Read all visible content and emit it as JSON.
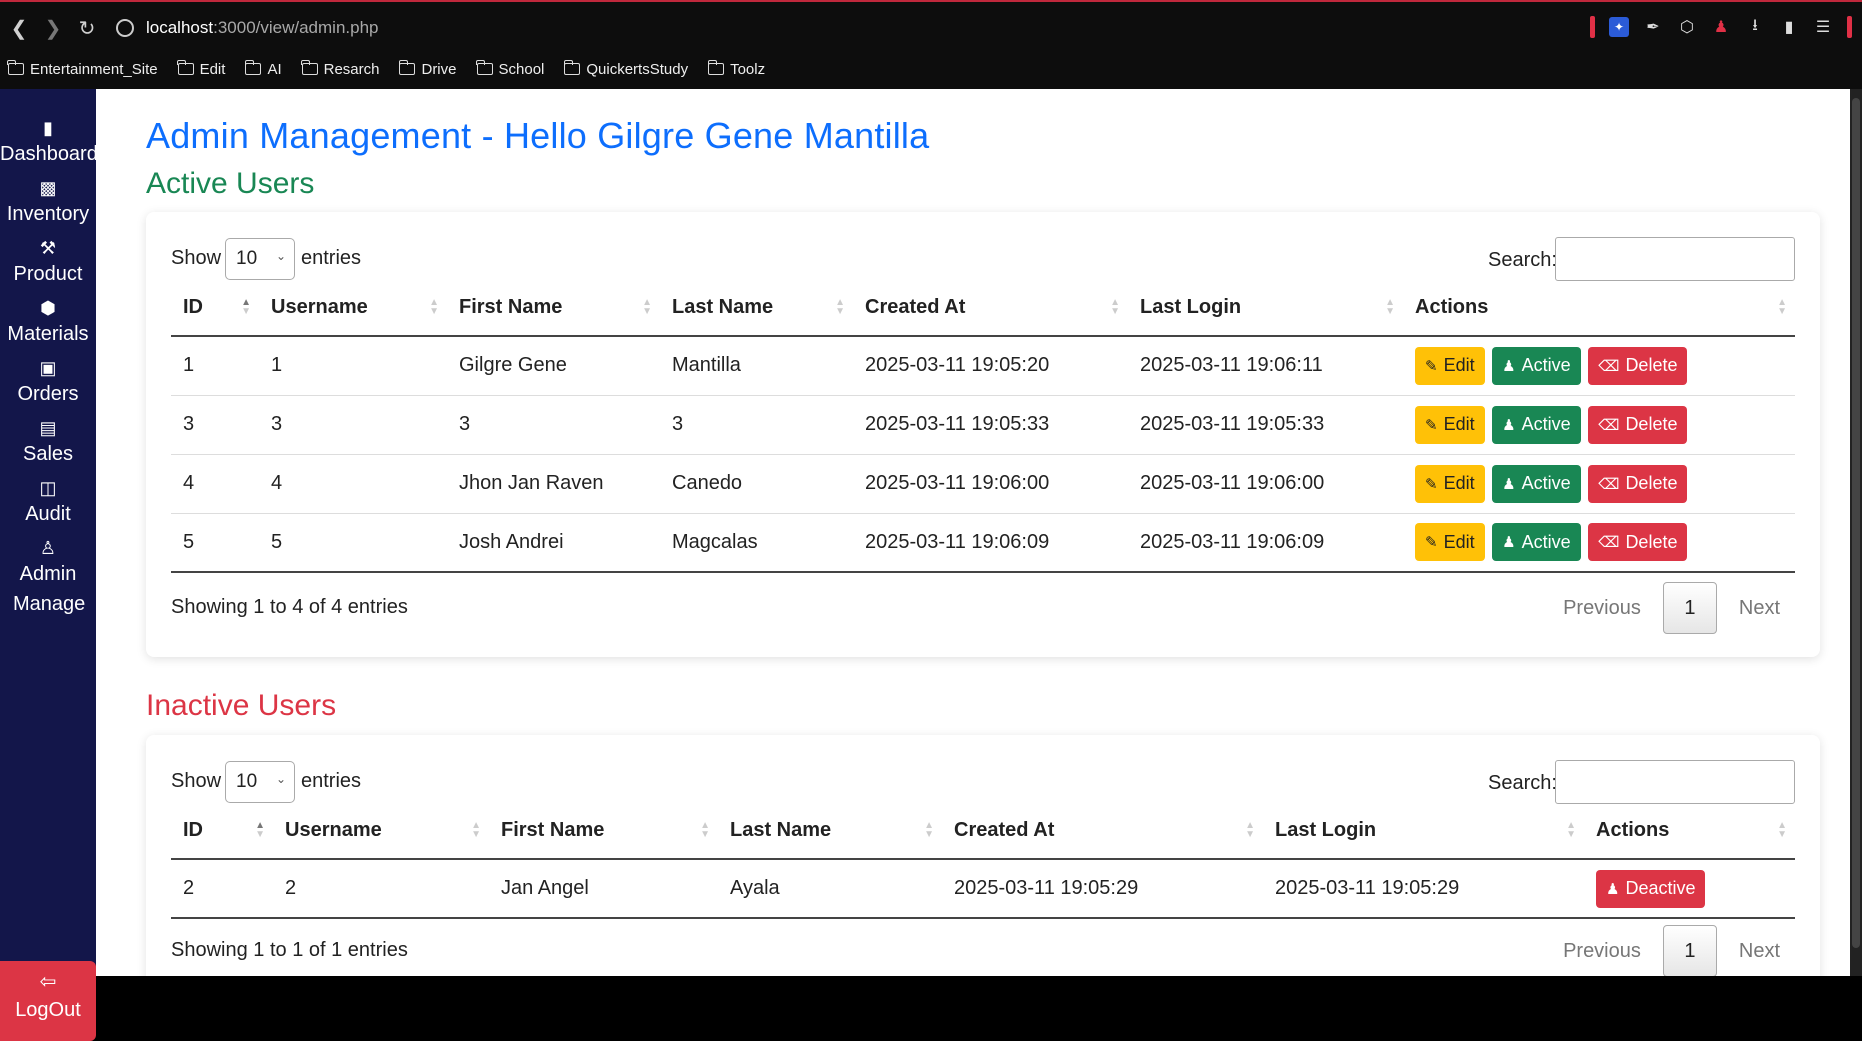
{
  "browser": {
    "url_host": "localhost",
    "url_rest": ":3000/view/admin.php",
    "bookmarks": [
      "Entertainment_Site",
      "Edit",
      "AI",
      "Resarch",
      "Drive",
      "School",
      "QuickertsStudy",
      "Toolz"
    ]
  },
  "sidebar": {
    "items": [
      {
        "label": "Dashboard",
        "icon": "bookmark-icon"
      },
      {
        "label": "Inventory",
        "icon": "bag-icon"
      },
      {
        "label": "Product",
        "icon": "hammer-icon"
      },
      {
        "label": "Materials",
        "icon": "hexagon-icon"
      },
      {
        "label": "Orders",
        "icon": "basket-icon"
      },
      {
        "label": "Sales",
        "icon": "receipt-icon"
      },
      {
        "label": "Audit",
        "icon": "journal-icon"
      },
      {
        "label": "Admin Manage",
        "icon": "person-gear-icon"
      }
    ],
    "logout": "LogOut"
  },
  "page": {
    "title": "Admin Management - Hello Gilgre Gene Mantilla",
    "active_heading": "Active Users",
    "inactive_heading": "Inactive Users"
  },
  "active_table": {
    "show_label": "Show",
    "entries_value": "10",
    "entries_label": "entries",
    "search_label": "Search:",
    "columns": [
      "ID",
      "Username",
      "First Name",
      "Last Name",
      "Created At",
      "Last Login",
      "Actions"
    ],
    "rows": [
      {
        "id": "1",
        "username": "1",
        "first": "Gilgre Gene",
        "last": "Mantilla",
        "created": "2025-03-11 19:05:20",
        "login": "2025-03-11 19:06:11"
      },
      {
        "id": "3",
        "username": "3",
        "first": "3",
        "last": "3",
        "created": "2025-03-11 19:05:33",
        "login": "2025-03-11 19:05:33"
      },
      {
        "id": "4",
        "username": "4",
        "first": "Jhon Jan Raven",
        "last": "Canedo",
        "created": "2025-03-11 19:06:00",
        "login": "2025-03-11 19:06:00"
      },
      {
        "id": "5",
        "username": "5",
        "first": "Josh Andrei",
        "last": "Magcalas",
        "created": "2025-03-11 19:06:09",
        "login": "2025-03-11 19:06:09"
      }
    ],
    "btn_edit": "Edit",
    "btn_active": "Active",
    "btn_delete": "Delete",
    "info": "Showing 1 to 4 of 4 entries",
    "prev": "Previous",
    "page": "1",
    "next": "Next"
  },
  "inactive_table": {
    "show_label": "Show",
    "entries_value": "10",
    "entries_label": "entries",
    "search_label": "Search:",
    "columns": [
      "ID",
      "Username",
      "First Name",
      "Last Name",
      "Created At",
      "Last Login",
      "Actions"
    ],
    "rows": [
      {
        "id": "2",
        "username": "2",
        "first": "Jan Angel",
        "last": "Ayala",
        "created": "2025-03-11 19:05:29",
        "login": "2025-03-11 19:05:29"
      }
    ],
    "btn_deactive": "Deactive",
    "info": "Showing 1 to 1 of 1 entries",
    "prev": "Previous",
    "page": "1",
    "next": "Next"
  },
  "colors": {
    "primary": "#0d6efd",
    "success": "#198754",
    "danger": "#dc3545",
    "warning": "#ffc107",
    "sidebar": "#13164a"
  }
}
